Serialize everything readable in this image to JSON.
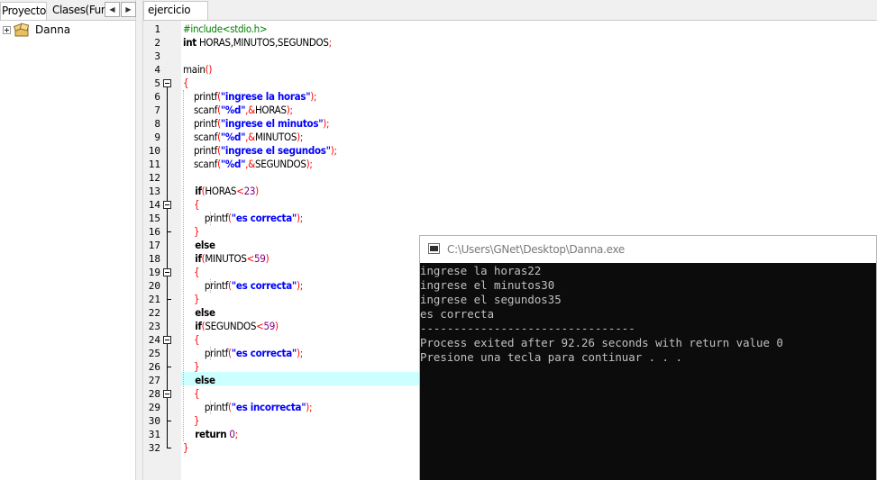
{
  "left_panel": {
    "tabs": [
      {
        "label": "Proyecto"
      },
      {
        "label": "Clases(Fun"
      }
    ],
    "scroll_left_glyph": "◀",
    "scroll_right_glyph": "▶",
    "tree": {
      "root_label": "Danna"
    }
  },
  "editor": {
    "tab_label": "ejercicio B.c",
    "current_line": 27,
    "line_numbers": [
      "1",
      "2",
      "3",
      "4",
      "5",
      "6",
      "7",
      "8",
      "9",
      "10",
      "11",
      "12",
      "13",
      "14",
      "15",
      "16",
      "17",
      "18",
      "19",
      "20",
      "21",
      "22",
      "23",
      "24",
      "25",
      "26",
      "27",
      "28",
      "29",
      "30",
      "31",
      "32"
    ],
    "code_lines": [
      [
        {
          "t": "#include<stdio.h>",
          "c": "pre"
        }
      ],
      [
        {
          "t": "int",
          "c": "kw"
        },
        {
          "t": " HORAS,MINUTOS,SEGUNDOS",
          "c": "plain"
        },
        {
          "t": ";",
          "c": "sym"
        }
      ],
      [],
      [
        {
          "t": "main",
          "c": "plain"
        },
        {
          "t": "()",
          "c": "sym"
        }
      ],
      [
        {
          "t": "{",
          "c": "sym"
        }
      ],
      [
        {
          "t": "    printf",
          "c": "plain"
        },
        {
          "t": "(",
          "c": "sym"
        },
        {
          "t": "\"ingrese la horas\"",
          "c": "str"
        },
        {
          "t": ");",
          "c": "sym"
        }
      ],
      [
        {
          "t": "    scanf",
          "c": "plain"
        },
        {
          "t": "(",
          "c": "sym"
        },
        {
          "t": "\"%d\"",
          "c": "str"
        },
        {
          "t": ",&",
          "c": "sym"
        },
        {
          "t": "HORAS",
          "c": "plain"
        },
        {
          "t": ");",
          "c": "sym"
        }
      ],
      [
        {
          "t": "    printf",
          "c": "plain"
        },
        {
          "t": "(",
          "c": "sym"
        },
        {
          "t": "\"ingrese el minutos\"",
          "c": "str"
        },
        {
          "t": ");",
          "c": "sym"
        }
      ],
      [
        {
          "t": "    scanf",
          "c": "plain"
        },
        {
          "t": "(",
          "c": "sym"
        },
        {
          "t": "\"%d\"",
          "c": "str"
        },
        {
          "t": ",&",
          "c": "sym"
        },
        {
          "t": "MINUTOS",
          "c": "plain"
        },
        {
          "t": ");",
          "c": "sym"
        }
      ],
      [
        {
          "t": "    printf",
          "c": "plain"
        },
        {
          "t": "(",
          "c": "sym"
        },
        {
          "t": "\"ingrese el segundos\"",
          "c": "str"
        },
        {
          "t": ");",
          "c": "sym"
        }
      ],
      [
        {
          "t": "    scanf",
          "c": "plain"
        },
        {
          "t": "(",
          "c": "sym"
        },
        {
          "t": "\"%d\"",
          "c": "str"
        },
        {
          "t": ",&",
          "c": "sym"
        },
        {
          "t": "SEGUNDOS",
          "c": "plain"
        },
        {
          "t": ");",
          "c": "sym"
        }
      ],
      [],
      [
        {
          "t": "    if",
          "c": "kw"
        },
        {
          "t": "(",
          "c": "sym"
        },
        {
          "t": "HORAS",
          "c": "plain"
        },
        {
          "t": "<",
          "c": "sym"
        },
        {
          "t": "23",
          "c": "num"
        },
        {
          "t": ")",
          "c": "sym"
        }
      ],
      [
        {
          "t": "    {",
          "c": "sym"
        }
      ],
      [
        {
          "t": "        printf",
          "c": "plain"
        },
        {
          "t": "(",
          "c": "sym"
        },
        {
          "t": "\"es correcta\"",
          "c": "str"
        },
        {
          "t": ");",
          "c": "sym"
        }
      ],
      [
        {
          "t": "    }",
          "c": "sym"
        }
      ],
      [
        {
          "t": "    else",
          "c": "kw"
        }
      ],
      [
        {
          "t": "    if",
          "c": "kw"
        },
        {
          "t": "(",
          "c": "sym"
        },
        {
          "t": "MINUTOS",
          "c": "plain"
        },
        {
          "t": "<",
          "c": "sym"
        },
        {
          "t": "59",
          "c": "num"
        },
        {
          "t": ")",
          "c": "sym"
        }
      ],
      [
        {
          "t": "    {",
          "c": "sym"
        }
      ],
      [
        {
          "t": "        printf",
          "c": "plain"
        },
        {
          "t": "(",
          "c": "sym"
        },
        {
          "t": "\"es correcta\"",
          "c": "str"
        },
        {
          "t": ");",
          "c": "sym"
        }
      ],
      [
        {
          "t": "    }",
          "c": "sym"
        }
      ],
      [
        {
          "t": "    else",
          "c": "kw"
        }
      ],
      [
        {
          "t": "    if",
          "c": "kw"
        },
        {
          "t": "(",
          "c": "sym"
        },
        {
          "t": "SEGUNDOS",
          "c": "plain"
        },
        {
          "t": "<",
          "c": "sym"
        },
        {
          "t": "59",
          "c": "num"
        },
        {
          "t": ")",
          "c": "sym"
        }
      ],
      [
        {
          "t": "    {",
          "c": "sym"
        }
      ],
      [
        {
          "t": "        printf",
          "c": "plain"
        },
        {
          "t": "(",
          "c": "sym"
        },
        {
          "t": "\"es correcta\"",
          "c": "str"
        },
        {
          "t": ");",
          "c": "sym"
        }
      ],
      [
        {
          "t": "    }",
          "c": "sym"
        }
      ],
      [
        {
          "t": "    else",
          "c": "kw"
        }
      ],
      [
        {
          "t": "    {",
          "c": "sym"
        }
      ],
      [
        {
          "t": "        printf",
          "c": "plain"
        },
        {
          "t": "(",
          "c": "sym"
        },
        {
          "t": "\"es incorrecta\"",
          "c": "str"
        },
        {
          "t": ");",
          "c": "sym"
        }
      ],
      [
        {
          "t": "    }",
          "c": "sym"
        }
      ],
      [
        {
          "t": "    return",
          "c": "kw"
        },
        {
          "t": " ",
          "c": "plain"
        },
        {
          "t": "0",
          "c": "num"
        },
        {
          "t": ";",
          "c": "sym"
        }
      ],
      [
        {
          "t": "}",
          "c": "sym"
        }
      ]
    ],
    "colors": {
      "keyword": "#000000",
      "string": "#0000ff",
      "number": "#800080",
      "preprocessor": "#008000",
      "symbol": "#ff0000",
      "current_line_bg": "#ccffff"
    }
  },
  "console": {
    "title": "C:\\Users\\GNet\\Desktop\\Danna.exe",
    "lines": [
      "ingrese la horas22",
      "ingrese el minutos30",
      "ingrese el segundos35",
      "es correcta",
      "--------------------------------",
      "Process exited after 92.26 seconds with return value 0",
      "Presione una tecla para continuar . . ."
    ],
    "colors": {
      "background": "#0c0c0c",
      "text": "#c0c0c0"
    }
  }
}
